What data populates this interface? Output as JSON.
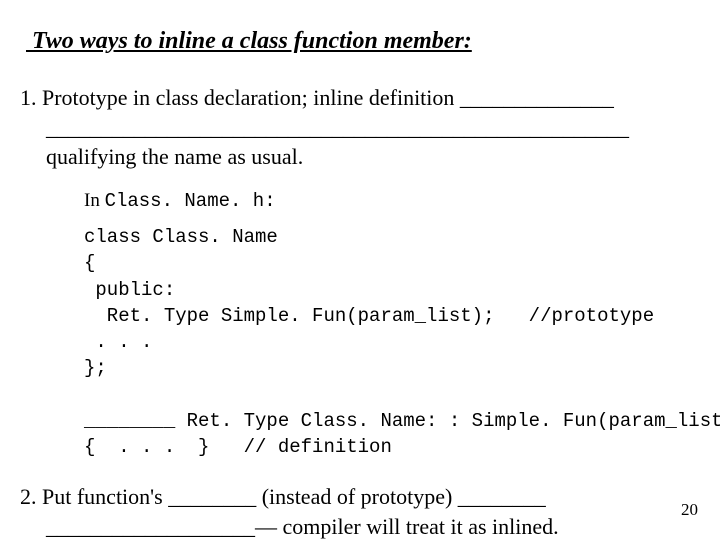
{
  "heading": " Two ways to inline a class function member:",
  "para1": {
    "line1": "1. Prototype in class declaration; inline definition ______________",
    "line2": "_____________________________________________________",
    "line3": "qualifying the name as usual."
  },
  "codeheader": {
    "prefix": "In  ",
    "filename": "Class. Name. h:"
  },
  "code": {
    "l1": "class Class. Name",
    "l2": "{",
    "l3": " public:",
    "l4": "  Ret. Type Simple. Fun(param_list);   //prototype",
    "l5": " . . .",
    "l6": "};",
    "l7": "",
    "l8": "________ Ret. Type Class. Name: : Simple. Fun(param_list)",
    "l9": "{  . . .  }   // definition"
  },
  "para2": {
    "line1": "2. Put function's ________ (instead of prototype) ________",
    "line2": "___________________— compiler will treat it as inlined."
  },
  "pagenum": "20"
}
